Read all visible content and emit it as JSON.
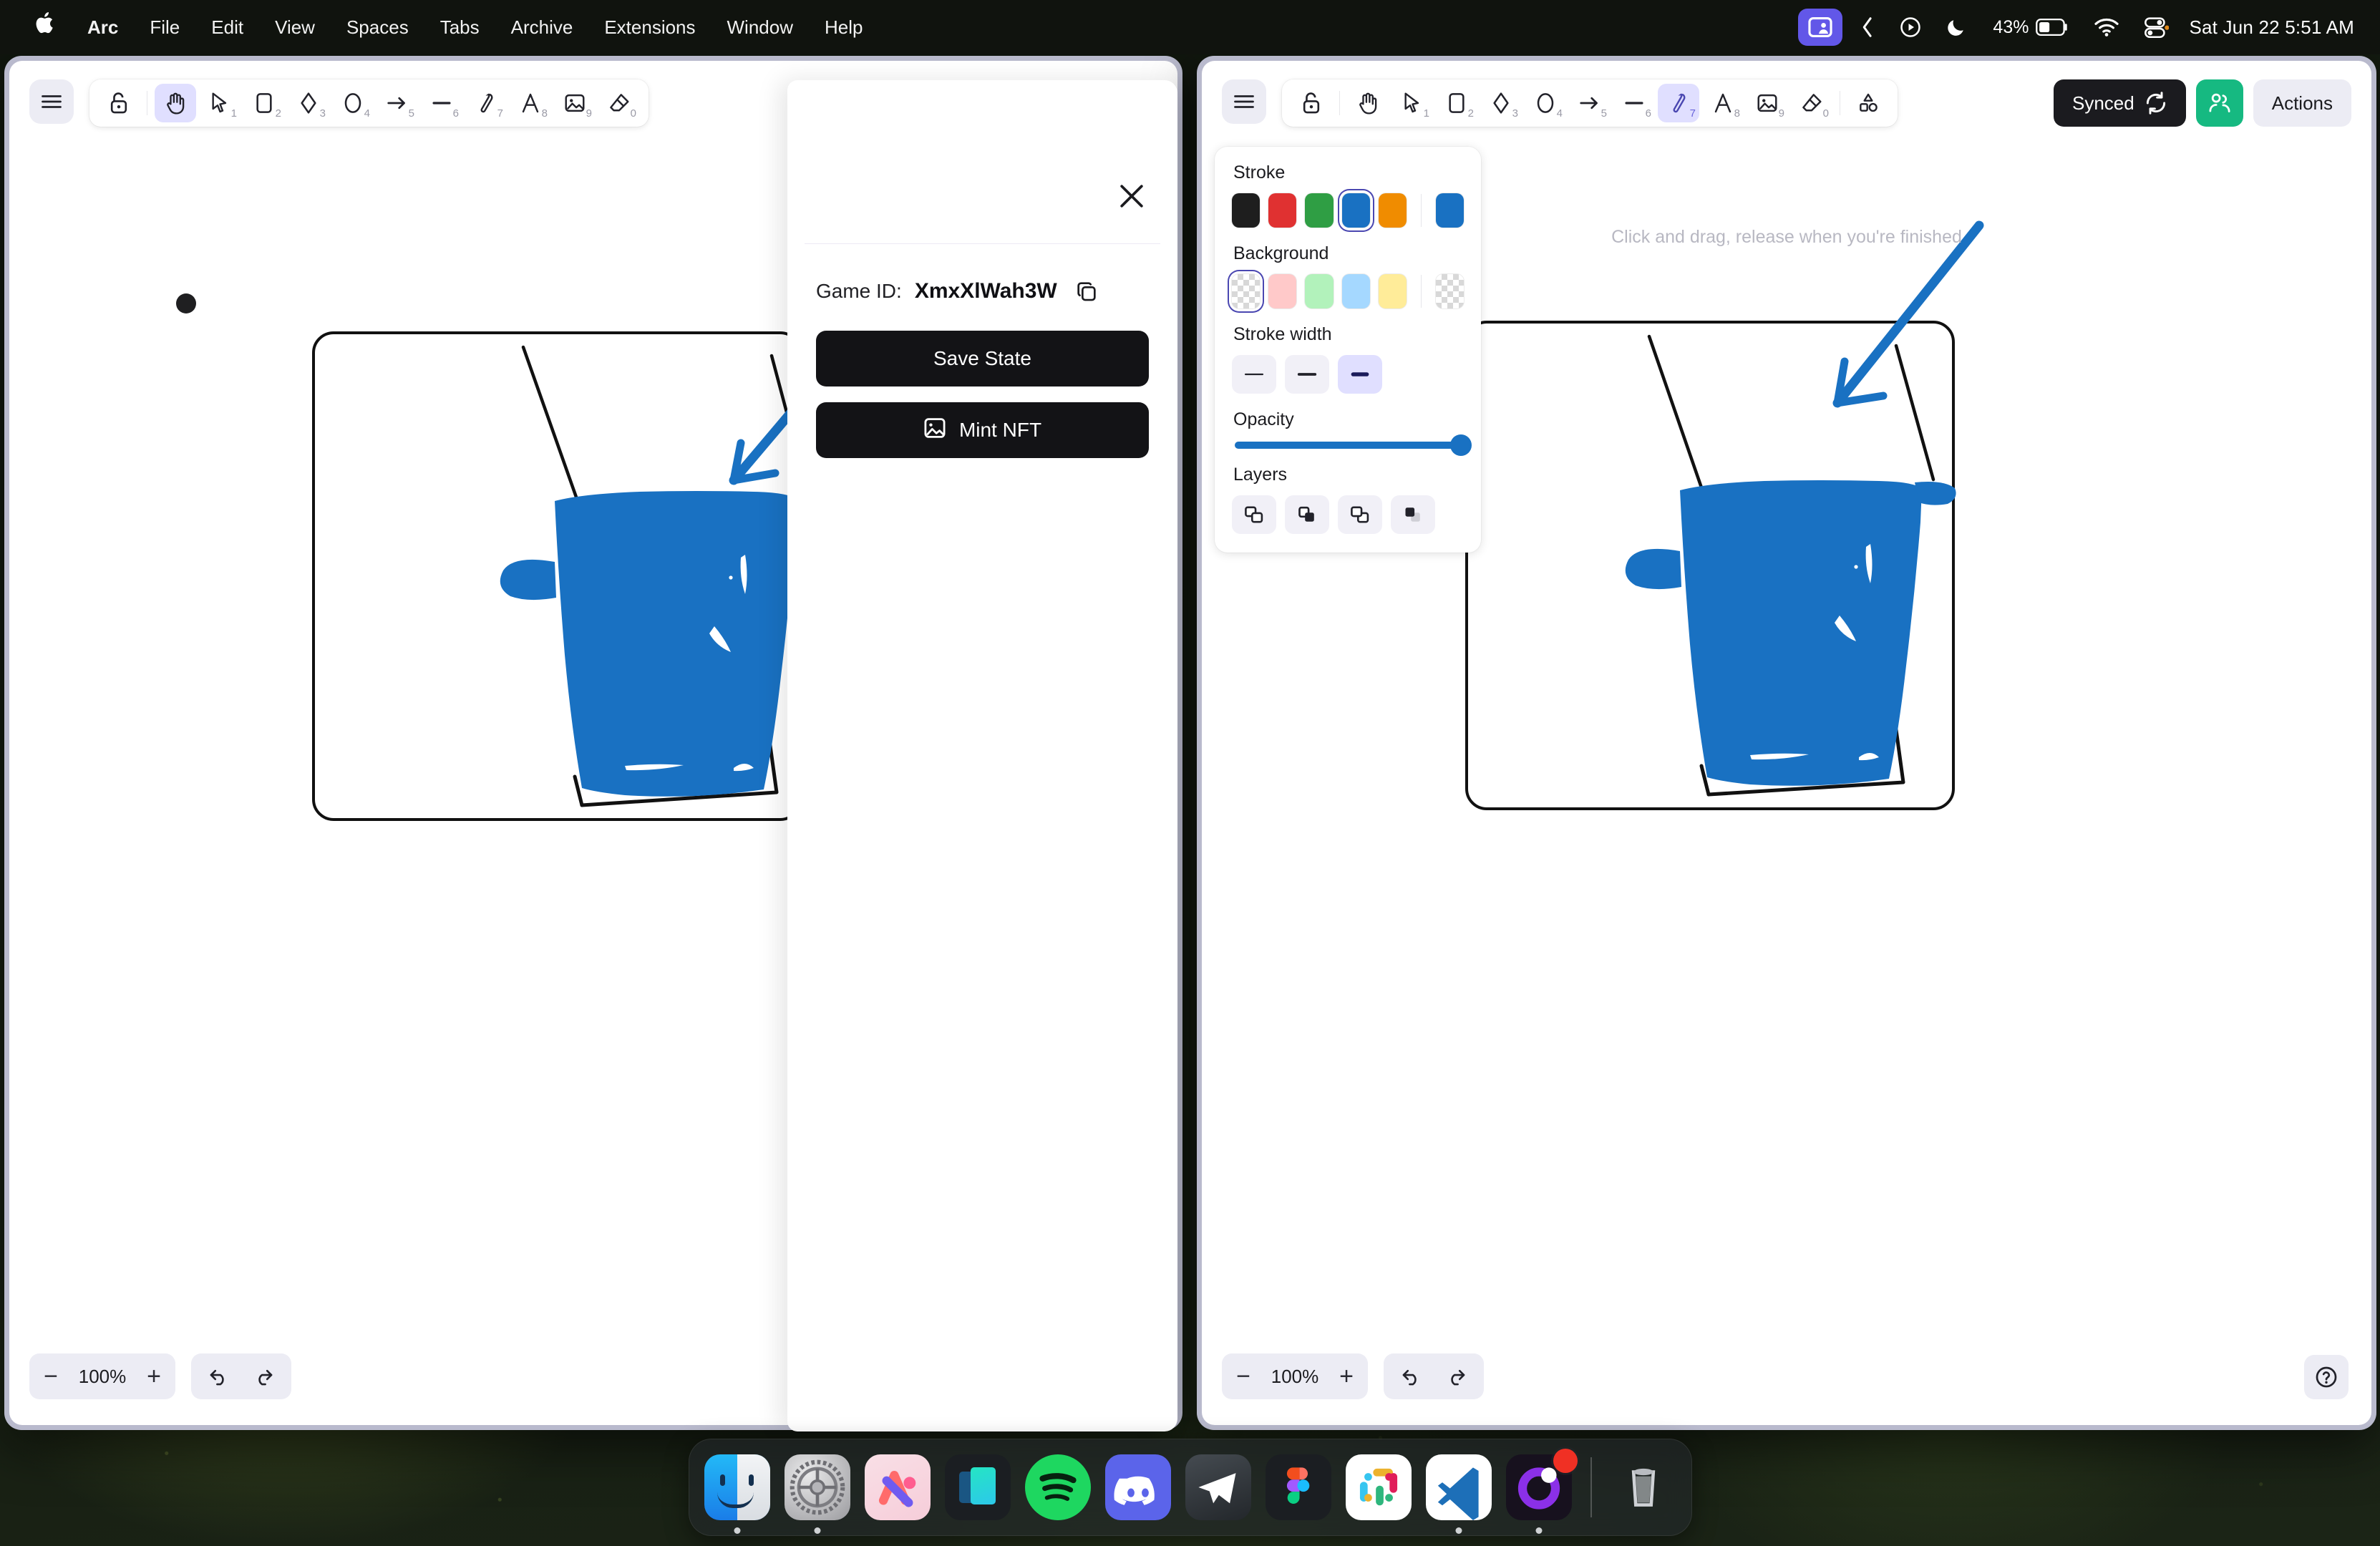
{
  "menubar": {
    "apple_glyph": "●",
    "items": [
      {
        "label": "Arc",
        "bold": true
      },
      {
        "label": "File",
        "bold": false
      },
      {
        "label": "Edit",
        "bold": false
      },
      {
        "label": "View",
        "bold": false
      },
      {
        "label": "Spaces",
        "bold": false
      },
      {
        "label": "Tabs",
        "bold": false
      },
      {
        "label": "Archive",
        "bold": false
      },
      {
        "label": "Extensions",
        "bold": false
      },
      {
        "label": "Window",
        "bold": false
      },
      {
        "label": "Help",
        "bold": false
      }
    ],
    "status": {
      "screenshare_icon": "screen-share-icon",
      "chevron_icon": "chevron-left-icon",
      "play_icon": "play-circle-icon",
      "moon_icon": "moon-icon",
      "battery_percent": "43%",
      "battery_icon": "battery-icon",
      "wifi_icon": "wifi-icon",
      "control_center_icon": "control-center-icon",
      "datetime": "Sat Jun 22  5:51 AM"
    }
  },
  "toolbar": {
    "menu_icon": "hamburger-menu-icon",
    "lock_icon": "unlocked-padlock-icon",
    "tools": [
      {
        "name": "hand-tool",
        "num": "",
        "icon": "hand-icon"
      },
      {
        "name": "selection-tool",
        "num": "1",
        "icon": "cursor-arrow-icon"
      },
      {
        "name": "rectangle-tool",
        "num": "2",
        "icon": "rectangle-icon"
      },
      {
        "name": "diamond-tool",
        "num": "3",
        "icon": "diamond-icon"
      },
      {
        "name": "ellipse-tool",
        "num": "4",
        "icon": "ellipse-icon"
      },
      {
        "name": "arrow-tool",
        "num": "5",
        "icon": "arrow-right-icon"
      },
      {
        "name": "line-tool",
        "num": "6",
        "icon": "line-icon"
      },
      {
        "name": "draw-tool",
        "num": "7",
        "icon": "pencil-icon"
      },
      {
        "name": "text-tool",
        "num": "8",
        "icon": "text-a-icon"
      },
      {
        "name": "image-tool",
        "num": "9",
        "icon": "image-icon"
      },
      {
        "name": "eraser-tool",
        "num": "0",
        "icon": "eraser-icon"
      },
      {
        "name": "shapes-tool",
        "num": "",
        "icon": "frame-shapes-icon"
      }
    ],
    "active_tool_left": "hand-tool",
    "active_tool_right": "draw-tool",
    "synced_label": "Synced",
    "synced_icon": "sync-refresh-icon",
    "collab_icon": "collaborators-icon",
    "actions_label": "Actions"
  },
  "right_window": {
    "hint": "Click and drag, release when you're finished"
  },
  "properties": {
    "stroke": {
      "label": "Stroke",
      "swatches": [
        "#1e1e1e",
        "#e03131",
        "#2f9e44",
        "#1971c2",
        "#f08c00"
      ],
      "selected_index": 3,
      "current": "#1971c2"
    },
    "background": {
      "label": "Background",
      "swatches": [
        "transparent",
        "#ffc9c9",
        "#b2f2bb",
        "#a5d8ff",
        "#ffec99"
      ],
      "selected_index": 0,
      "current": "transparent"
    },
    "stroke_width": {
      "label": "Stroke width",
      "options": [
        "thin",
        "bold",
        "extra-bold"
      ],
      "selected_index": 2
    },
    "opacity": {
      "label": "Opacity",
      "value": 100
    },
    "layers": {
      "label": "Layers",
      "options": [
        "send-to-back",
        "send-backward",
        "bring-forward",
        "bring-to-front"
      ]
    }
  },
  "bottom": {
    "zoom_out_label": "−",
    "zoom_value": "100%",
    "zoom_in_label": "+",
    "undo_icon": "undo-arrow-icon",
    "redo_icon": "redo-arrow-icon",
    "help_icon": "help-question-icon"
  },
  "modal": {
    "close_icon": "close-x-icon",
    "game_id_label": "Game ID:",
    "game_id_value": "XmxXlWah3W",
    "copy_icon": "copy-icon",
    "save_state_label": "Save State",
    "mint_nft_label": "Mint NFT",
    "mint_nft_icon": "image-frame-icon"
  },
  "drawing": {
    "description": "bucket-sketch",
    "fill_color": "#1971c2",
    "outline_color": "#111111"
  },
  "dock": {
    "items": [
      {
        "name": "finder",
        "running": true
      },
      {
        "name": "system-settings",
        "running": true
      },
      {
        "name": "arc-browser-pink",
        "running": false
      },
      {
        "name": "notes-app",
        "running": false
      },
      {
        "name": "spotify",
        "running": false
      },
      {
        "name": "discord",
        "running": false
      },
      {
        "name": "telegram",
        "running": false
      },
      {
        "name": "figma",
        "running": false
      },
      {
        "name": "slack",
        "running": false
      },
      {
        "name": "vs-code",
        "running": true
      },
      {
        "name": "arc-browser",
        "running": true,
        "badge": true
      }
    ],
    "trash_name": "trash"
  }
}
